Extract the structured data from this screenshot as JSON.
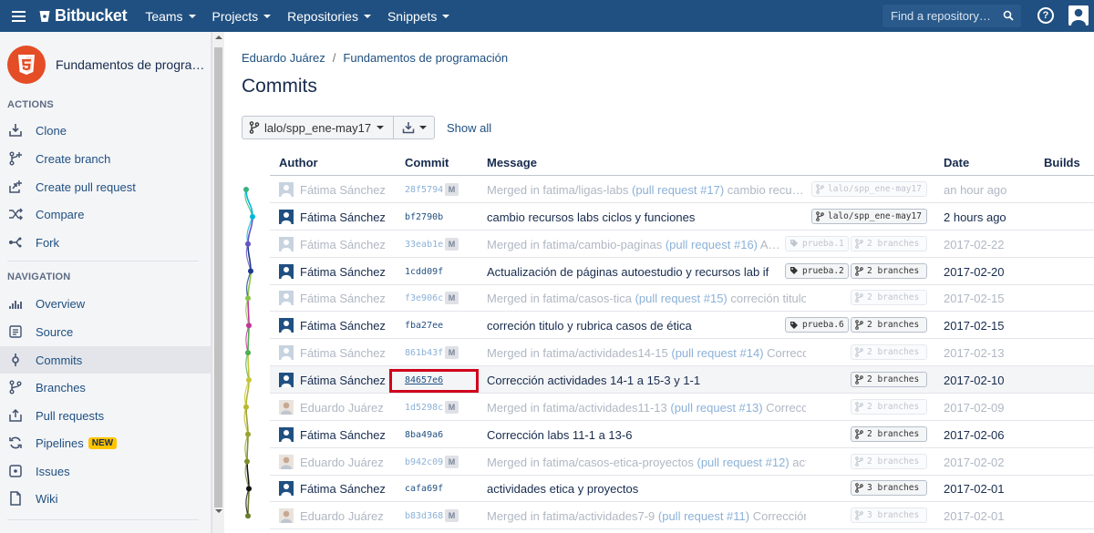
{
  "topbar": {
    "logo": "Bitbucket",
    "nav": [
      {
        "label": "Teams"
      },
      {
        "label": "Projects"
      },
      {
        "label": "Repositories"
      },
      {
        "label": "Snippets"
      }
    ],
    "search_placeholder": "Find a repository…",
    "colors": {
      "bar": "#205081"
    }
  },
  "sidebar": {
    "repo_name": "Fundamentos de progra…",
    "actions_title": "ACTIONS",
    "actions": [
      {
        "label": "Clone",
        "icon": "clone-icon"
      },
      {
        "label": "Create branch",
        "icon": "create-branch-icon"
      },
      {
        "label": "Create pull request",
        "icon": "create-pull-request-icon"
      },
      {
        "label": "Compare",
        "icon": "compare-icon"
      },
      {
        "label": "Fork",
        "icon": "fork-icon"
      }
    ],
    "navigation_title": "NAVIGATION",
    "navigation": [
      {
        "label": "Overview",
        "icon": "overview-icon"
      },
      {
        "label": "Source",
        "icon": "source-icon"
      },
      {
        "label": "Commits",
        "icon": "commits-icon",
        "active": true
      },
      {
        "label": "Branches",
        "icon": "branches-icon"
      },
      {
        "label": "Pull requests",
        "icon": "pull-requests-icon"
      },
      {
        "label": "Pipelines",
        "icon": "pipelines-icon",
        "badge": "NEW"
      },
      {
        "label": "Issues",
        "icon": "issues-icon"
      },
      {
        "label": "Wiki",
        "icon": "wiki-icon"
      }
    ]
  },
  "main": {
    "breadcrumb": {
      "owner": "Eduardo Juárez",
      "separator": "/",
      "repo": "Fundamentos de programación"
    },
    "title": "Commits",
    "branch_selector": "lalo/spp_ene-may17",
    "show_all": "Show all",
    "columns": {
      "author": "Author",
      "commit": "Commit",
      "message": "Message",
      "date": "Date",
      "builds": "Builds"
    },
    "commits": [
      {
        "author": "Fátima Sánchez",
        "hash": "28f5794",
        "merge": true,
        "message": "Merged in fatima/ligas-labs",
        "pr": "(pull request #17)",
        "rest": " cambio recu…",
        "tags": [
          {
            "icon": "branch",
            "text": "lalo/spp_ene-may17"
          }
        ],
        "date": "an hour ago"
      },
      {
        "author": "Fátima Sánchez",
        "hash": "bf2790b",
        "merge": false,
        "message": "cambio recursos labs ciclos y funciones",
        "pr": "",
        "rest": "",
        "tags": [
          {
            "icon": "branch",
            "text": "lalo/spp_ene-may17"
          }
        ],
        "date": "2 hours ago"
      },
      {
        "author": "Fátima Sánchez",
        "hash": "33eab1e",
        "merge": true,
        "message": "Merged in fatima/cambio-paginas",
        "pr": "(pull request #16)",
        "rest": " A…",
        "tags": [
          {
            "icon": "tag",
            "text": "prueba.1"
          },
          {
            "icon": "branch",
            "text": "2 branches"
          }
        ],
        "date": "2017-02-22"
      },
      {
        "author": "Fátima Sánchez",
        "hash": "1cdd09f",
        "merge": false,
        "message": "Actualización de páginas autoestudio y recursos lab if",
        "pr": "",
        "rest": "",
        "tags": [
          {
            "icon": "tag",
            "text": "prueba.2"
          },
          {
            "icon": "branch",
            "text": "2 branches"
          }
        ],
        "date": "2017-02-20"
      },
      {
        "author": "Fátima Sánchez",
        "hash": "f3e906c",
        "merge": true,
        "message": "Merged in fatima/casos-tica",
        "pr": "(pull request #15)",
        "rest": " correción titulo y ru…",
        "tags": [
          {
            "icon": "branch",
            "text": "2 branches"
          }
        ],
        "date": "2017-02-15"
      },
      {
        "author": "Fátima Sánchez",
        "hash": "fba27ee",
        "merge": false,
        "message": "correción titulo y rubrica casos de ética",
        "pr": "",
        "rest": "",
        "tags": [
          {
            "icon": "tag",
            "text": "prueba.6"
          },
          {
            "icon": "branch",
            "text": "2 branches"
          }
        ],
        "date": "2017-02-15"
      },
      {
        "author": "Fátima Sánchez",
        "hash": "861b43f",
        "merge": true,
        "message": "Merged in fatima/actividades14-15",
        "pr": "(pull request #14)",
        "rest": " Corrección a…",
        "tags": [
          {
            "icon": "branch",
            "text": "2 branches"
          }
        ],
        "date": "2017-02-13"
      },
      {
        "author": "Fátima Sánchez",
        "hash": "84657e6",
        "merge": false,
        "highlight": true,
        "message": "Corrección actividades 14-1 a 15-3 y 1-1",
        "pr": "",
        "rest": "",
        "tags": [
          {
            "icon": "branch",
            "text": "2 branches"
          }
        ],
        "date": "2017-02-10"
      },
      {
        "author": "Eduardo Juárez",
        "hash": "1d5298c",
        "merge": true,
        "message": "Merged in fatima/actividades11-13",
        "pr": "(pull request #13)",
        "rest": " Corrección la…",
        "tags": [
          {
            "icon": "branch",
            "text": "2 branches"
          }
        ],
        "date": "2017-02-09"
      },
      {
        "author": "Fátima Sánchez",
        "hash": "8ba49a6",
        "merge": false,
        "message": "Corrección labs 11-1 a 13-6",
        "pr": "",
        "rest": "",
        "tags": [
          {
            "icon": "branch",
            "text": "2 branches"
          }
        ],
        "date": "2017-02-06"
      },
      {
        "author": "Eduardo Juárez",
        "hash": "b942c09",
        "merge": true,
        "message": "Merged in fatima/casos-etica-proyectos",
        "pr": "(pull request #12)",
        "rest": " activida…",
        "tags": [
          {
            "icon": "branch",
            "text": "2 branches"
          }
        ],
        "date": "2017-02-02"
      },
      {
        "author": "Fátima Sánchez",
        "hash": "cafa69f",
        "merge": false,
        "message": "actividades etica y proyectos",
        "pr": "",
        "rest": "",
        "tags": [
          {
            "icon": "branch",
            "text": "3 branches"
          }
        ],
        "date": "2017-02-01"
      },
      {
        "author": "Eduardo Juárez",
        "hash": "b83d368",
        "merge": true,
        "message": "Merged in fatima/actividades7-9",
        "pr": "(pull request #11)",
        "rest": " Corrección a…",
        "tags": [
          {
            "icon": "branch",
            "text": "3 branches"
          }
        ],
        "date": "2017-02-01"
      }
    ],
    "merge_badge": "M"
  }
}
